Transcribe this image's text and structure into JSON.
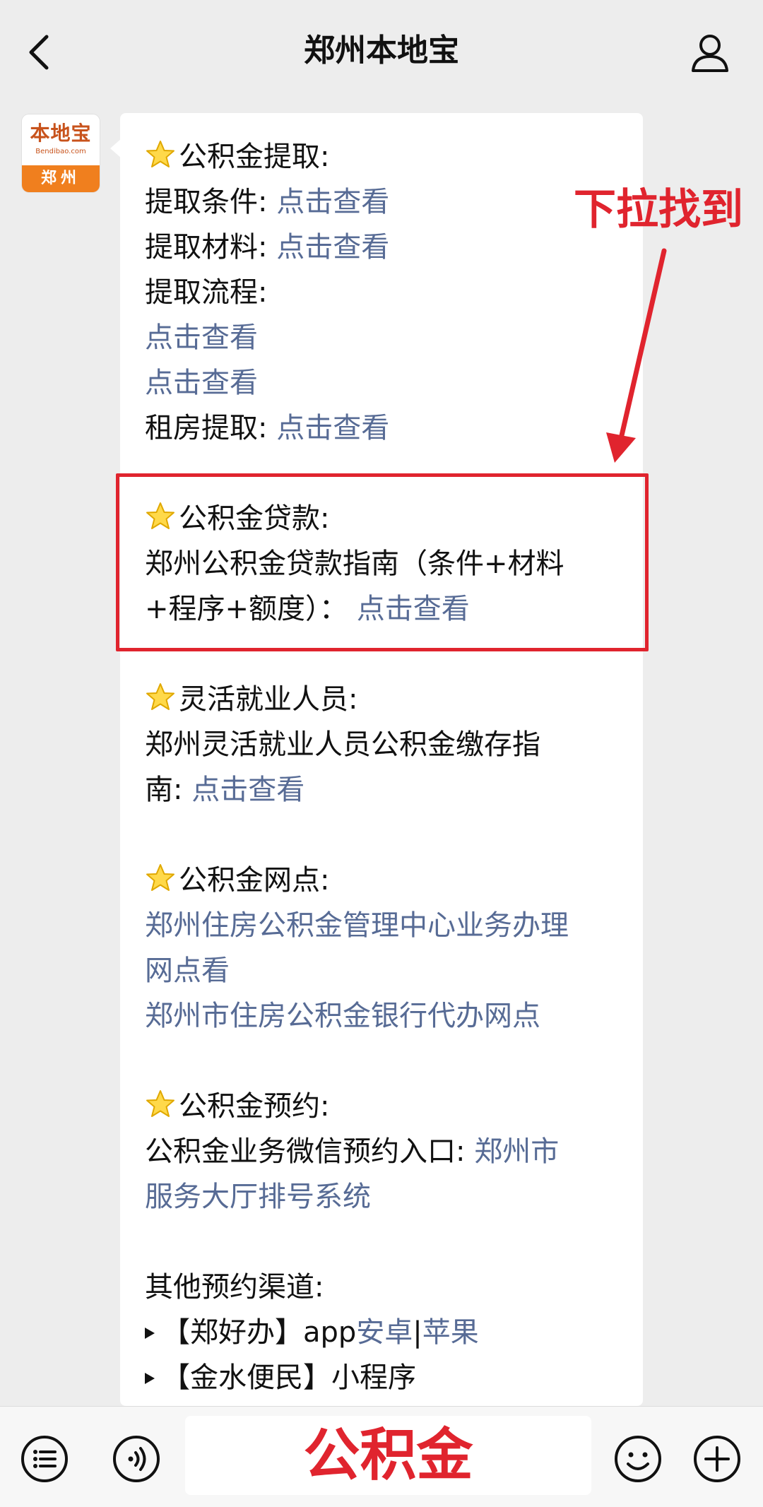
{
  "header": {
    "title": "郑州本地宝"
  },
  "avatar": {
    "brand": "本地宝",
    "domain": "Bendibao.com",
    "city": "郑州"
  },
  "article": {
    "s1_title": "公积金提取:",
    "s1_l1_label": "提取条件:",
    "s1_l2_label": "提取材料:",
    "s1_l3_label": "提取流程:",
    "s1_l6_label": "租房提取:",
    "link_text": "点击查看",
    "s2_title": "公积金贷款:",
    "s2_l1": "郑州公积金贷款指南（条件+材料",
    "s2_l2": "+程序+额度）：",
    "s3_title": "灵活就业人员:",
    "s3_l1": "郑州灵活就业人员公积金缴存指",
    "s3_l2": "南:",
    "s4_title": "公积金网点:",
    "s4_l1": "郑州住房公积金管理中心业务办理",
    "s4_l2": "网点看",
    "s4_l3": "郑州市住房公积金银行代办网点",
    "s5_title": "公积金预约:",
    "s5_l1_label": "公积金业务微信预约入口:",
    "s5_l1_link": "郑州市",
    "s5_l2_link": "服务大厅排号系统",
    "s6_title": "其他预约渠道:",
    "s6_i1_prefix": "【郑好办】app",
    "s6_i1_link1": "安卓",
    "s6_i1_sep": "|",
    "s6_i1_link2": "苹果",
    "s6_i2": "【金水便民】小程序"
  },
  "annotation": {
    "label": "下拉找到",
    "color": "#e0242e"
  },
  "input": {
    "text": "公积金"
  },
  "colors": {
    "link": "#576b95",
    "annotation": "#e0242e",
    "background": "#ededed"
  },
  "icons": [
    "back-chevron-icon",
    "user-icon",
    "star-icon",
    "menu-list-icon",
    "voice-icon",
    "emoji-icon",
    "plus-icon"
  ]
}
